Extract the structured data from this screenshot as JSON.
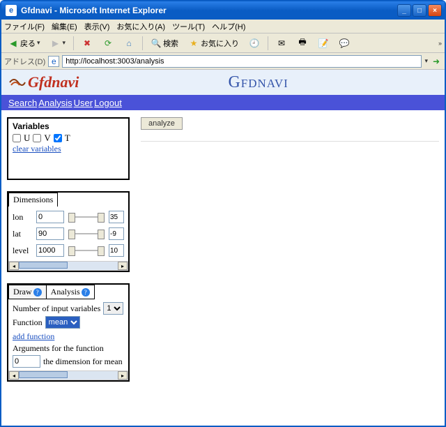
{
  "window": {
    "title": "Gfdnavi - Microsoft Internet Explorer"
  },
  "menu": {
    "file": "ファイル(F)",
    "edit": "編集(E)",
    "view": "表示(V)",
    "fav": "お気に入り(A)",
    "tools": "ツール(T)",
    "help": "ヘルプ(H)"
  },
  "toolbar": {
    "back": "戻る",
    "search": "検索",
    "favorites": "お気に入り"
  },
  "address": {
    "label": "アドレス(D)",
    "url": "http://localhost:3003/analysis"
  },
  "brand": {
    "logo_text": "Gfdnavi",
    "title": "Gfdnavi"
  },
  "nav": {
    "search": "Search",
    "analysis": "Analysis",
    "user": "User",
    "logout": "Logout"
  },
  "variables": {
    "title": "Variables",
    "items": [
      {
        "label": "U",
        "checked": false
      },
      {
        "label": "V",
        "checked": false
      },
      {
        "label": "T",
        "checked": true
      }
    ],
    "clear": "clear variables"
  },
  "dimensions": {
    "tab": "Dimensions",
    "rows": [
      {
        "label": "lon",
        "from": "0",
        "to": "35"
      },
      {
        "label": "lat",
        "from": "90",
        "to": "-9"
      },
      {
        "label": "level",
        "from": "1000",
        "to": "10"
      }
    ]
  },
  "draw": {
    "tab_draw": "Draw",
    "tab_analysis": "Analysis",
    "num_inputs_label": "Number of input variables",
    "num_inputs_value": "1",
    "function_label": "Function",
    "function_value": "mean",
    "add_function": "add function",
    "args_label": "Arguments for the function",
    "arg_value": "0",
    "arg_desc": "the dimension for mean"
  },
  "main": {
    "analyze": "analyze"
  }
}
